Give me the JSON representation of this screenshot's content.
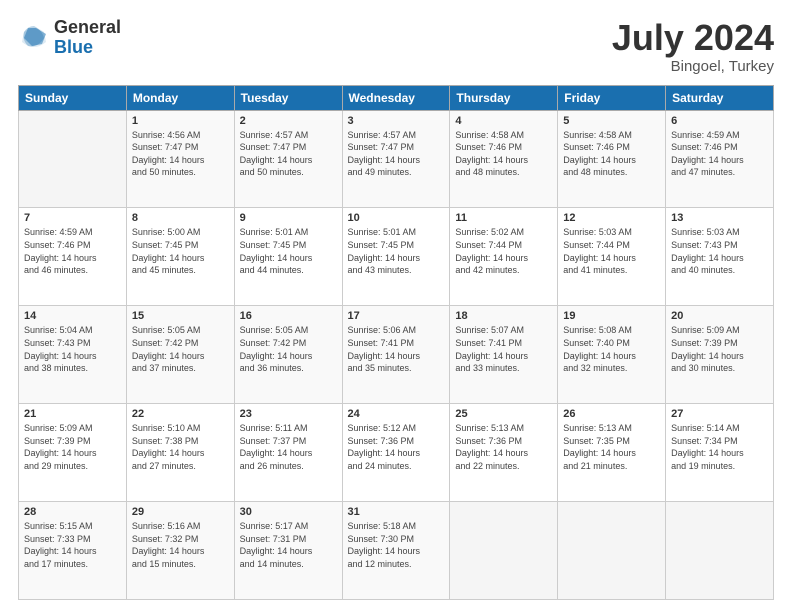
{
  "header": {
    "logo_general": "General",
    "logo_blue": "Blue",
    "month_year": "July 2024",
    "location": "Bingoel, Turkey"
  },
  "weekdays": [
    "Sunday",
    "Monday",
    "Tuesday",
    "Wednesday",
    "Thursday",
    "Friday",
    "Saturday"
  ],
  "weeks": [
    [
      {
        "day": "",
        "info": ""
      },
      {
        "day": "1",
        "info": "Sunrise: 4:56 AM\nSunset: 7:47 PM\nDaylight: 14 hours\nand 50 minutes."
      },
      {
        "day": "2",
        "info": "Sunrise: 4:57 AM\nSunset: 7:47 PM\nDaylight: 14 hours\nand 50 minutes."
      },
      {
        "day": "3",
        "info": "Sunrise: 4:57 AM\nSunset: 7:47 PM\nDaylight: 14 hours\nand 49 minutes."
      },
      {
        "day": "4",
        "info": "Sunrise: 4:58 AM\nSunset: 7:46 PM\nDaylight: 14 hours\nand 48 minutes."
      },
      {
        "day": "5",
        "info": "Sunrise: 4:58 AM\nSunset: 7:46 PM\nDaylight: 14 hours\nand 48 minutes."
      },
      {
        "day": "6",
        "info": "Sunrise: 4:59 AM\nSunset: 7:46 PM\nDaylight: 14 hours\nand 47 minutes."
      }
    ],
    [
      {
        "day": "7",
        "info": "Sunrise: 4:59 AM\nSunset: 7:46 PM\nDaylight: 14 hours\nand 46 minutes."
      },
      {
        "day": "8",
        "info": "Sunrise: 5:00 AM\nSunset: 7:45 PM\nDaylight: 14 hours\nand 45 minutes."
      },
      {
        "day": "9",
        "info": "Sunrise: 5:01 AM\nSunset: 7:45 PM\nDaylight: 14 hours\nand 44 minutes."
      },
      {
        "day": "10",
        "info": "Sunrise: 5:01 AM\nSunset: 7:45 PM\nDaylight: 14 hours\nand 43 minutes."
      },
      {
        "day": "11",
        "info": "Sunrise: 5:02 AM\nSunset: 7:44 PM\nDaylight: 14 hours\nand 42 minutes."
      },
      {
        "day": "12",
        "info": "Sunrise: 5:03 AM\nSunset: 7:44 PM\nDaylight: 14 hours\nand 41 minutes."
      },
      {
        "day": "13",
        "info": "Sunrise: 5:03 AM\nSunset: 7:43 PM\nDaylight: 14 hours\nand 40 minutes."
      }
    ],
    [
      {
        "day": "14",
        "info": "Sunrise: 5:04 AM\nSunset: 7:43 PM\nDaylight: 14 hours\nand 38 minutes."
      },
      {
        "day": "15",
        "info": "Sunrise: 5:05 AM\nSunset: 7:42 PM\nDaylight: 14 hours\nand 37 minutes."
      },
      {
        "day": "16",
        "info": "Sunrise: 5:05 AM\nSunset: 7:42 PM\nDaylight: 14 hours\nand 36 minutes."
      },
      {
        "day": "17",
        "info": "Sunrise: 5:06 AM\nSunset: 7:41 PM\nDaylight: 14 hours\nand 35 minutes."
      },
      {
        "day": "18",
        "info": "Sunrise: 5:07 AM\nSunset: 7:41 PM\nDaylight: 14 hours\nand 33 minutes."
      },
      {
        "day": "19",
        "info": "Sunrise: 5:08 AM\nSunset: 7:40 PM\nDaylight: 14 hours\nand 32 minutes."
      },
      {
        "day": "20",
        "info": "Sunrise: 5:09 AM\nSunset: 7:39 PM\nDaylight: 14 hours\nand 30 minutes."
      }
    ],
    [
      {
        "day": "21",
        "info": "Sunrise: 5:09 AM\nSunset: 7:39 PM\nDaylight: 14 hours\nand 29 minutes."
      },
      {
        "day": "22",
        "info": "Sunrise: 5:10 AM\nSunset: 7:38 PM\nDaylight: 14 hours\nand 27 minutes."
      },
      {
        "day": "23",
        "info": "Sunrise: 5:11 AM\nSunset: 7:37 PM\nDaylight: 14 hours\nand 26 minutes."
      },
      {
        "day": "24",
        "info": "Sunrise: 5:12 AM\nSunset: 7:36 PM\nDaylight: 14 hours\nand 24 minutes."
      },
      {
        "day": "25",
        "info": "Sunrise: 5:13 AM\nSunset: 7:36 PM\nDaylight: 14 hours\nand 22 minutes."
      },
      {
        "day": "26",
        "info": "Sunrise: 5:13 AM\nSunset: 7:35 PM\nDaylight: 14 hours\nand 21 minutes."
      },
      {
        "day": "27",
        "info": "Sunrise: 5:14 AM\nSunset: 7:34 PM\nDaylight: 14 hours\nand 19 minutes."
      }
    ],
    [
      {
        "day": "28",
        "info": "Sunrise: 5:15 AM\nSunset: 7:33 PM\nDaylight: 14 hours\nand 17 minutes."
      },
      {
        "day": "29",
        "info": "Sunrise: 5:16 AM\nSunset: 7:32 PM\nDaylight: 14 hours\nand 15 minutes."
      },
      {
        "day": "30",
        "info": "Sunrise: 5:17 AM\nSunset: 7:31 PM\nDaylight: 14 hours\nand 14 minutes."
      },
      {
        "day": "31",
        "info": "Sunrise: 5:18 AM\nSunset: 7:30 PM\nDaylight: 14 hours\nand 12 minutes."
      },
      {
        "day": "",
        "info": ""
      },
      {
        "day": "",
        "info": ""
      },
      {
        "day": "",
        "info": ""
      }
    ]
  ]
}
